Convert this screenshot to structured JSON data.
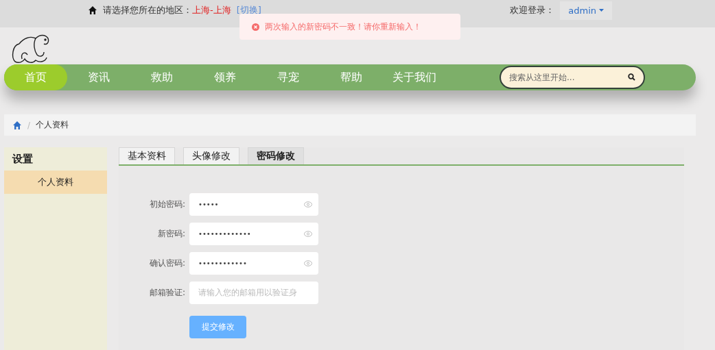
{
  "top_bar": {
    "region_label": "请选择您所在的地区：",
    "region": "上海-上海",
    "switch_link": "[切换]",
    "welcome": "欢迎登录：",
    "user": "admin"
  },
  "toast": {
    "message": "两次输入的新密码不一致！请你重新输入！"
  },
  "nav": {
    "items": [
      {
        "label": "首页",
        "selected": true
      },
      {
        "label": "资讯",
        "selected": false
      },
      {
        "label": "救助",
        "selected": false
      },
      {
        "label": "领养",
        "selected": false
      },
      {
        "label": "寻宠",
        "selected": false
      },
      {
        "label": "帮助",
        "selected": false
      },
      {
        "label": "关于我们",
        "selected": false
      }
    ],
    "search": {
      "placeholder": "搜索从这里开始..."
    }
  },
  "breadcrumb": {
    "separator": "/",
    "current": "个人资料"
  },
  "sidebar": {
    "title": "设置",
    "items": [
      {
        "label": "个人资料",
        "selected": true
      }
    ]
  },
  "tabs": [
    {
      "label": "基本资料",
      "selected": false
    },
    {
      "label": "头像修改",
      "selected": false
    },
    {
      "label": "密码修改",
      "selected": true
    }
  ],
  "form": {
    "fields": [
      {
        "label": "初始密码:",
        "value": "•••••",
        "kind": "password"
      },
      {
        "label": "新密码:",
        "value": "•••••••••••••",
        "kind": "password"
      },
      {
        "label": "确认密码:",
        "value": "••••••••••••",
        "kind": "password"
      },
      {
        "label": "邮箱验证:",
        "placeholder": "请输入您的邮箱用以验证身",
        "kind": "text"
      }
    ],
    "submit": "提交修改"
  }
}
